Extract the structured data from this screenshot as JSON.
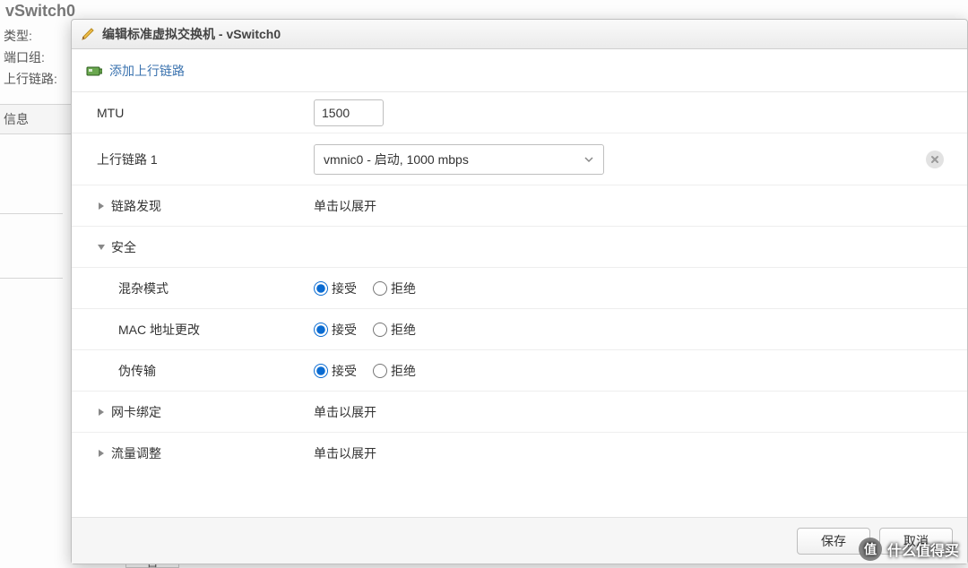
{
  "background": {
    "title": "vSwitch0",
    "label_type": "类型:",
    "label_portgroup": "端口组:",
    "label_uplink": "上行链路:",
    "info": "信息",
    "bottom_cell": "否"
  },
  "dialog": {
    "title": "编辑标准虚拟交换机 - vSwitch0",
    "toolbar": {
      "add_uplink": "添加上行链路"
    },
    "rows": {
      "mtu": {
        "label": "MTU",
        "value": "1500"
      },
      "uplink1": {
        "label": "上行链路 1",
        "selected": "vmnic0 - 启动, 1000 mbps"
      },
      "discovery": {
        "label": "链路发现",
        "value": "单击以展开"
      },
      "security": {
        "label": "安全"
      },
      "promiscuous": {
        "label": "混杂模式",
        "accept": "接受",
        "reject": "拒绝",
        "value": "accept"
      },
      "mac_change": {
        "label": "MAC 地址更改",
        "accept": "接受",
        "reject": "拒绝",
        "value": "accept"
      },
      "forged": {
        "label": "伪传输",
        "accept": "接受",
        "reject": "拒绝",
        "value": "accept"
      },
      "teaming": {
        "label": "网卡绑定",
        "value": "单击以展开"
      },
      "shaping": {
        "label": "流量调整",
        "value": "单击以展开"
      }
    },
    "footer": {
      "save": "保存",
      "cancel": "取消"
    }
  },
  "watermark": {
    "badge": "值",
    "text": "什么值得买"
  }
}
